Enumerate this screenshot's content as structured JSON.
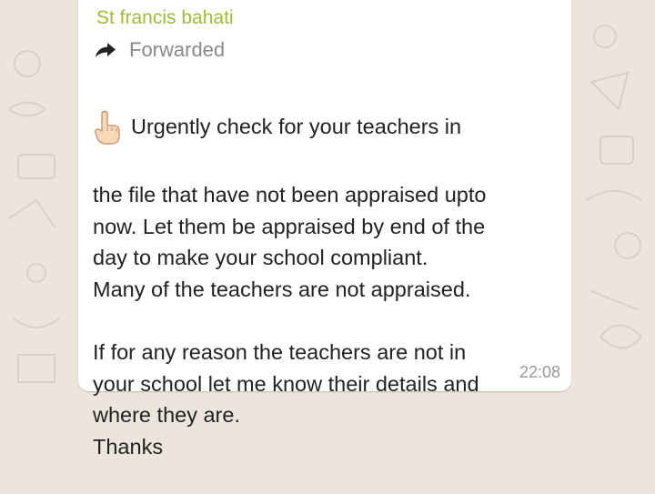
{
  "chat": {
    "sender_name": "St francis bahati",
    "forwarded_label": "Forwarded",
    "forward_icon": "forward-arrow-icon",
    "emoji_icon": "pointing-up-hand-icon",
    "message_first_line": "Urgently check for your teachers in",
    "message_body": "the file that have not been appraised upto\nnow. Let them be appraised by end of the\nday to make your school compliant.\nMany of the teachers are not appraised.\n\nIf for any reason the teachers are not in\nyour school let me know their details and\nwhere they are.\nThanks",
    "timestamp": "22:08",
    "colors": {
      "sender": "#9fbb3a",
      "background": "#ece5dd",
      "bubble": "#ffffff"
    }
  }
}
